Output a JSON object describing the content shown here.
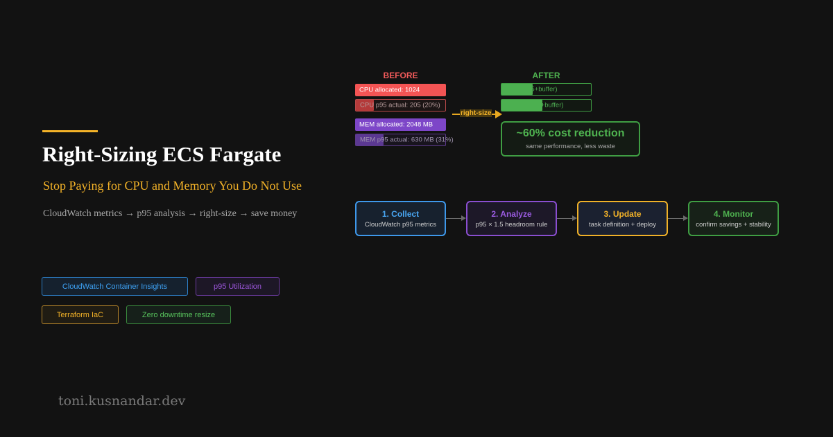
{
  "hero": {
    "title": "Right-Sizing ECS Fargate",
    "subtitle": "Stop Paying for CPU and Memory You Do Not Use",
    "tagline": "CloudWatch metrics → p95 analysis → right-size → save money"
  },
  "comparison": {
    "before_heading": "BEFORE",
    "after_heading": "AFTER",
    "before": {
      "cpu_allocated": "CPU allocated: 1024",
      "cpu_actual": "CPU p95 actual: 205 (20%)",
      "cpu_actual_fraction": 0.2,
      "mem_allocated": "MEM allocated: 2048 MB",
      "mem_actual": "MEM p95 actual: 630 MB (31%)",
      "mem_actual_fraction": 0.31
    },
    "after": {
      "cpu": "5 (fits p95+buffer)",
      "cpu_fraction": 0.35,
      "mem": "MB (fits p95+buffer)",
      "mem_fraction": 0.46
    },
    "transition_label": "right-size",
    "savings": {
      "headline": "~60% cost reduction",
      "detail": "same performance, less waste"
    }
  },
  "steps": [
    {
      "title": "1. Collect",
      "desc": "CloudWatch p95 metrics"
    },
    {
      "title": "2. Analyze",
      "desc": "p95 × 1.5 headroom rule"
    },
    {
      "title": "3. Update",
      "desc": "task definition + deploy"
    },
    {
      "title": "4. Monitor",
      "desc": "confirm savings + stability"
    }
  ],
  "tags": [
    "CloudWatch Container Insights",
    "p95 Utilization",
    "Terraform IaC",
    "Zero downtime resize"
  ],
  "footer": {
    "site": "toni.kusnandar.dev"
  },
  "colors": {
    "background": "#121212",
    "accent_yellow": "#f4b328",
    "before_red": "#f45454",
    "memory_purple": "#7d46c8",
    "after_green": "#4fb350",
    "collect_blue": "#3e98ea"
  }
}
